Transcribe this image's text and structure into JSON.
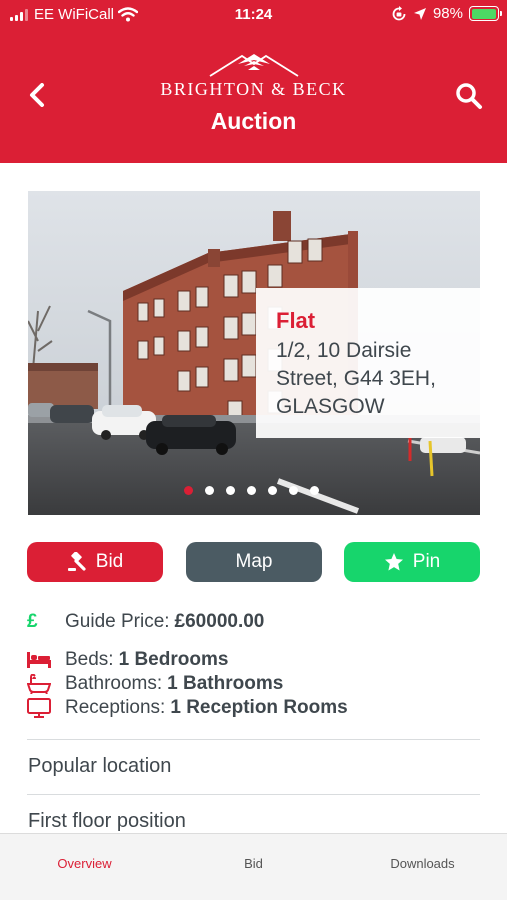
{
  "status_bar": {
    "carrier": "EE WiFiCall",
    "time": "11:24",
    "battery": "98%",
    "battery_level": 0.98,
    "icons": [
      "signal-icon",
      "wifi-icon",
      "orientation-lock-icon",
      "location-icon",
      "battery-charging-icon"
    ]
  },
  "header": {
    "brand": "BRIGHTON & BECK",
    "title": "Auction",
    "back_icon": "chevron-left-icon",
    "search_icon": "search-icon"
  },
  "listing": {
    "type": "Flat",
    "address": "1/2, 10 Dairsie Street,  G44 3EH, GLASGOW",
    "gallery_count": 7,
    "gallery_active_index": 0
  },
  "actions": {
    "bid": "Bid",
    "map": "Map",
    "pin": "Pin"
  },
  "details": {
    "currency_symbol": "£",
    "guide_label": "Guide Price:",
    "guide_value": "£60000.00",
    "beds_label": "Beds:",
    "beds_value": "1 Bedrooms",
    "baths_label": "Bathrooms:",
    "baths_value": "1 Bathrooms",
    "receptions_label": "Receptions:",
    "receptions_value": "1 Reception Rooms"
  },
  "features": [
    "Popular location",
    "First floor position"
  ],
  "tabs": [
    "Overview",
    "Bid",
    "Downloads"
  ],
  "colors": {
    "brand_red": "#db1f35",
    "map_grey": "#4b5b63",
    "pin_green": "#17d56c",
    "text": "#3f474d"
  }
}
